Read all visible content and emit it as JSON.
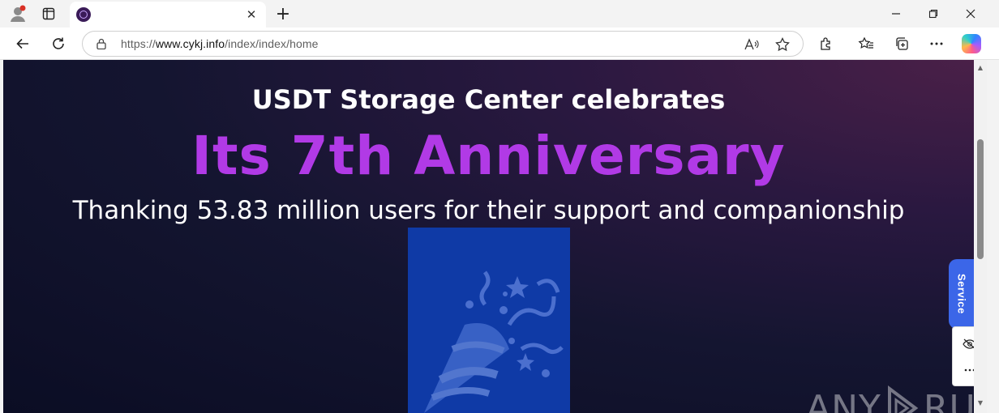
{
  "browser": {
    "tab": {
      "title": "",
      "close": "✕"
    },
    "new_tab": "+",
    "window": {
      "minimize": "—",
      "restore": "❐",
      "close": "✕"
    },
    "url_prefix": "https://",
    "url_host": "www.cykj.info",
    "url_path": "/index/index/home"
  },
  "page": {
    "headline": "USDT Storage Center celebrates",
    "title": "Its 7th Anniversary",
    "subtitle": "Thanking 53.83 million users for their support and companionship",
    "service_tab": "Service"
  },
  "watermark": {
    "left": "ANY",
    "right": "RUN"
  },
  "colors": {
    "title_purple": "#b13ae6",
    "banner_blue": "#0f3aa6",
    "service_blue": "#3b66e8"
  },
  "icons": [
    "profile-icon",
    "sidebar-toggle-icon",
    "site-favicon",
    "back-icon",
    "refresh-icon",
    "lock-icon",
    "read-aloud-icon",
    "favorite-star-icon",
    "extensions-icon",
    "favorites-icon",
    "collections-icon",
    "more-icon",
    "copilot-icon",
    "party-popper-icon",
    "hide-eye-icon"
  ]
}
